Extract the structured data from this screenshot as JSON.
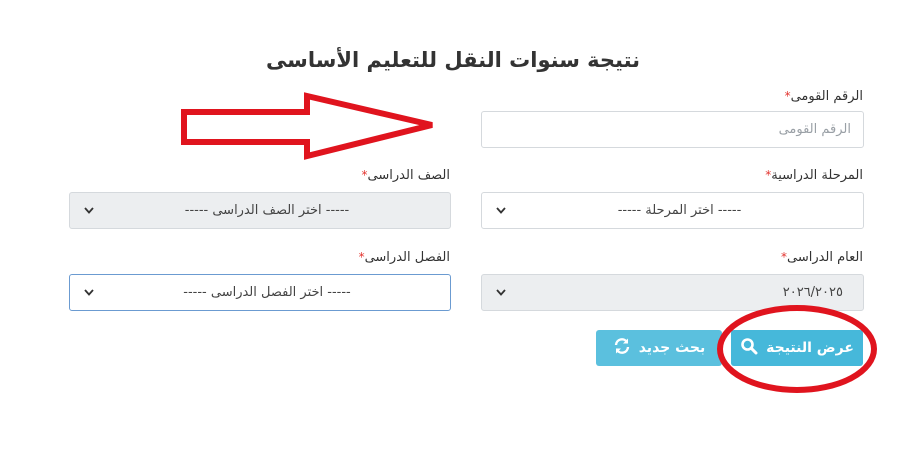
{
  "page": {
    "title": "نتيجة سنوات النقل للتعليم الأساسى"
  },
  "form": {
    "national_id": {
      "label": "الرقم القومى",
      "required_mark": "*",
      "placeholder": "الرقم القومى",
      "value": ""
    },
    "stage": {
      "label": "المرحلة الدراسية",
      "required_mark": "*",
      "selected": "----- اختر المرحلة -----"
    },
    "grade": {
      "label": "الصف الدراسى",
      "required_mark": "*",
      "selected": "----- اختر الصف الدراسى -----"
    },
    "year": {
      "label": "العام الدراسى",
      "required_mark": "*",
      "selected": "٢٠٢٦/٢٠٢٥"
    },
    "class": {
      "label": "الفصل الدراسى",
      "required_mark": "*",
      "selected": "----- اختر الفصل الدراسى -----"
    }
  },
  "actions": {
    "show_result_label": "عرض النتيجة",
    "new_search_label": "بحث جديد"
  },
  "colors": {
    "button": "#5bc0de",
    "annotation": "#e0141e",
    "required": "#e3342f"
  },
  "icons": {
    "show_result": "search-icon",
    "new_search": "refresh-icon",
    "select": "chevron-down-icon"
  }
}
